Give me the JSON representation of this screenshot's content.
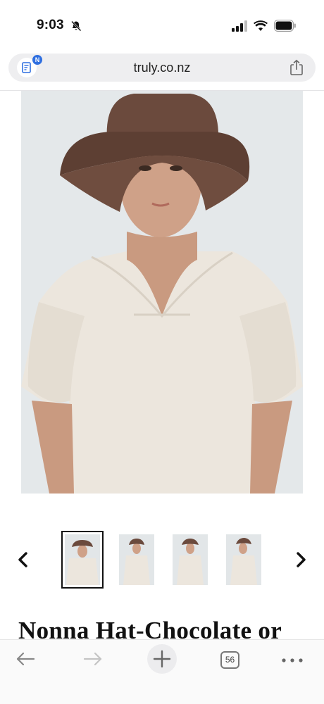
{
  "status_bar": {
    "time": "9:03",
    "icons": [
      "bell-slash-icon",
      "cellular-signal-icon",
      "wifi-icon",
      "battery-icon"
    ]
  },
  "browser": {
    "url": "truly.co.nz",
    "extension_badge": "N",
    "share_icon": "share-icon"
  },
  "gallery": {
    "main_image_alt": "Model wearing a wide-brim chocolate brown hat and a cream puff-sleeve top",
    "thumbnail_count": 4,
    "active_thumbnail": 0,
    "prev_icon": "chevron-left-icon",
    "next_icon": "chevron-right-icon"
  },
  "product": {
    "title": "Nonna Hat-Chocolate or"
  },
  "toolbar": {
    "tab_count": "56",
    "icons": [
      "back-arrow-icon",
      "forward-arrow-icon",
      "plus-icon",
      "tabs-icon",
      "more-icon"
    ]
  },
  "colors": {
    "hat": "#6b4a3d",
    "top": "#ece6dd",
    "background": "#e4e8ea",
    "skin": "#c99a80",
    "accent": "#2f6fe0"
  }
}
